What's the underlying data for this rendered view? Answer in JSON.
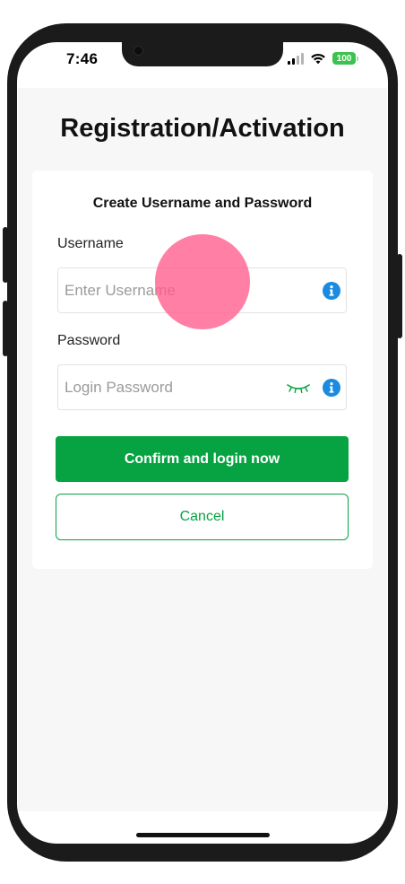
{
  "status_bar": {
    "time": "7:46",
    "battery_level": "100",
    "battery_color": "#3ec24f",
    "icons": [
      "signal-icon",
      "wifi-icon",
      "battery-icon"
    ]
  },
  "page": {
    "title": "Registration/Activation"
  },
  "form": {
    "heading": "Create Username and Password",
    "username": {
      "label": "Username",
      "placeholder": "Enter Username",
      "value": "",
      "icon": "info-icon"
    },
    "password": {
      "label": "Password",
      "placeholder": "Login Password",
      "value": "",
      "icons": [
        "eye-closed-icon",
        "info-icon"
      ]
    },
    "confirm_label": "Confirm and login now",
    "cancel_label": "Cancel"
  },
  "colors": {
    "accent": "#07a342",
    "info_icon": "#1a8be0",
    "touch_indicator": "#ff5c8a",
    "app_background": "#f7f7f7"
  }
}
